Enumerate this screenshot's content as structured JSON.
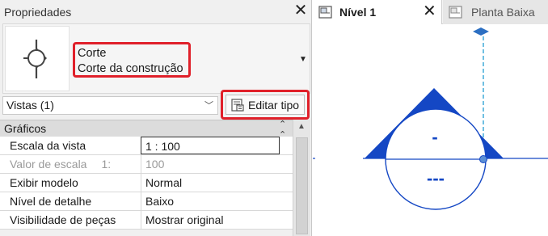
{
  "properties": {
    "title": "Propriedades",
    "type_selector": {
      "family": "Corte",
      "type": "Corte da construção"
    },
    "instance_filter": "Vistas (1)",
    "edit_type_label": "Editar tipo",
    "section": "Gráficos",
    "rows": [
      {
        "name": "Escala da vista",
        "value": "1 : 100"
      },
      {
        "name": "Valor de escala",
        "name_extra": "1:",
        "value": "100"
      },
      {
        "name": "Exibir modelo",
        "value": "Normal"
      },
      {
        "name": "Nível de detalhe",
        "value": "Baixo"
      },
      {
        "name": "Visibilidade de peças",
        "value": "Mostrar original"
      }
    ]
  },
  "tabs": [
    {
      "label": "Nível 1",
      "active": true
    },
    {
      "label": "Planta Baixa",
      "active": false
    }
  ],
  "view": {
    "level_marker_top": "-",
    "level_marker_bottom": "---",
    "colors": {
      "marker": "#1447c4",
      "highlight": "#e0202a",
      "guide": "#33a6d6"
    }
  }
}
